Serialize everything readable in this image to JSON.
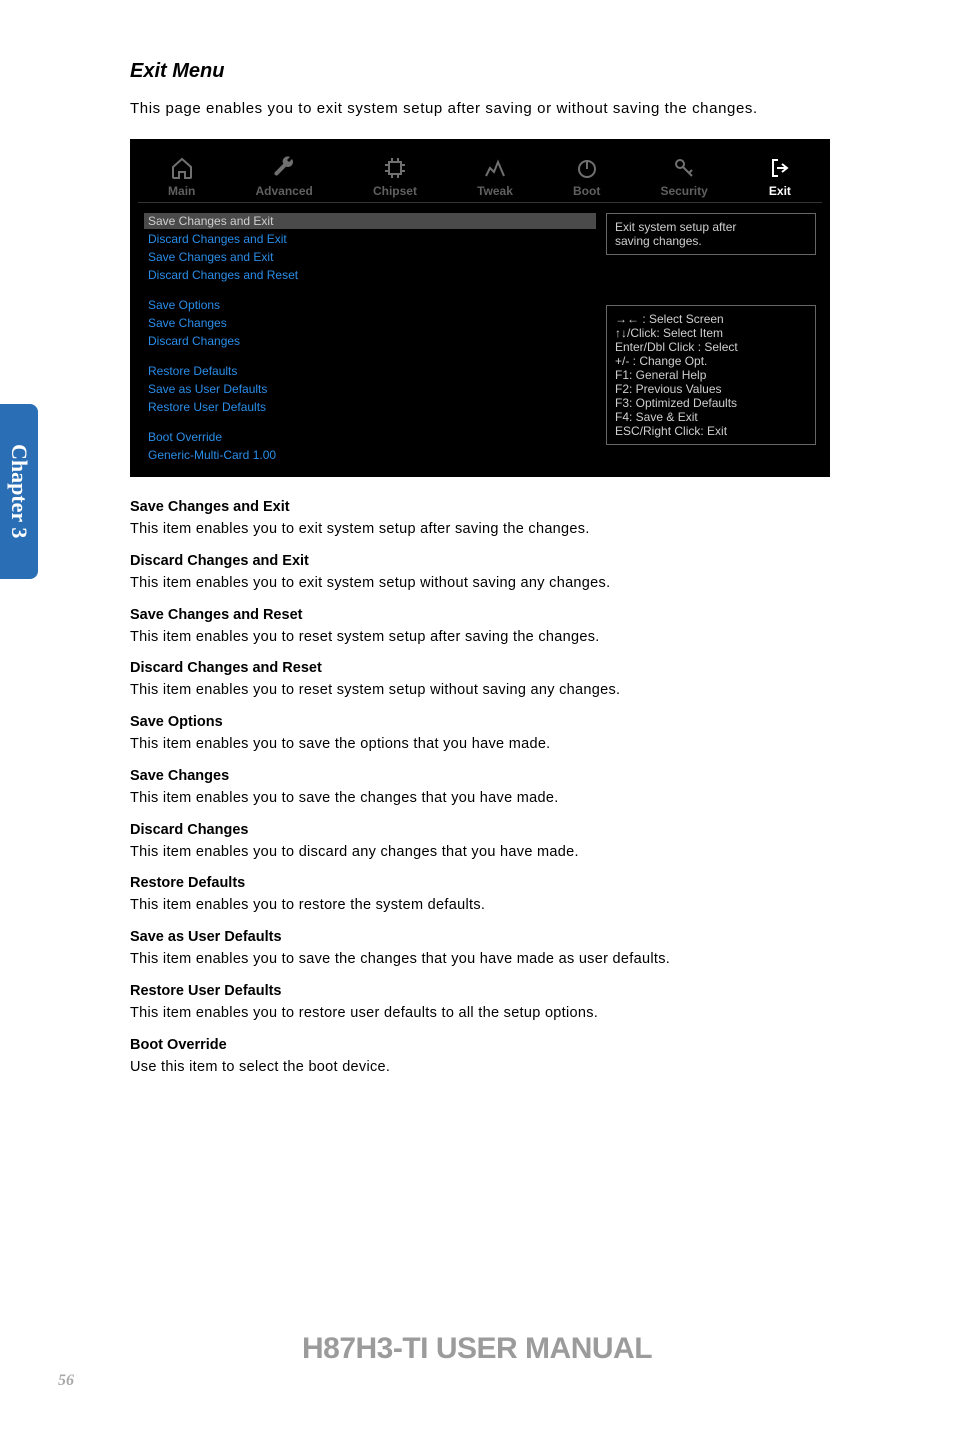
{
  "sideTab": "Chapter 3",
  "heading": "Exit Menu",
  "intro": "This page enables you to exit system setup after saving or without saving the changes.",
  "bios": {
    "tabs": [
      "Main",
      "Advanced",
      "Chipset",
      "Tweak",
      "Boot",
      "Security",
      "Exit"
    ],
    "leftGroups": {
      "g1": [
        {
          "label": "Save Changes and Exit",
          "sel": true
        },
        {
          "label": "Discard Changes and Exit"
        },
        {
          "label": "Save Changes and Exit"
        },
        {
          "label": "Discard Changes and Reset"
        }
      ],
      "g2": [
        {
          "label": "Save Options"
        },
        {
          "label": "Save Changes"
        },
        {
          "label": "Discard Changes"
        }
      ],
      "g3": [
        {
          "label": "Restore Defaults"
        },
        {
          "label": "Save as User Defaults"
        },
        {
          "label": "Restore User Defaults"
        }
      ],
      "g4": [
        {
          "label": "Boot Override"
        },
        {
          "label": "Generic-Multi-Card 1.00"
        }
      ]
    },
    "help": {
      "top1": "Exit system setup after",
      "top2": "saving changes.",
      "l1": "→←  : Select Screen",
      "l2": "↑↓/Click: Select Item",
      "l3": "Enter/Dbl Click : Select",
      "l4": "+/- : Change Opt.",
      "l5": "F1: General Help",
      "l6": "F2: Previous Values",
      "l7": "F3: Optimized Defaults",
      "l8": "F4: Save & Exit",
      "l9": "ESC/Right Click: Exit"
    }
  },
  "descriptions": [
    {
      "b": "Save Changes and Exit",
      "t": "This item enables you to exit system setup after saving the changes."
    },
    {
      "b": "Discard Changes and Exit",
      "t": "This item enables you to exit system setup without saving any changes."
    },
    {
      "b": "Save Changes and Reset",
      "t": "This item enables you to reset system setup after saving the changes."
    },
    {
      "b": "Discard Changes and Reset",
      "t": "This item enables you to reset system setup without saving any changes."
    },
    {
      "b": "Save Options",
      "t": "This item enables you to save the options that you have made."
    },
    {
      "b": "Save Changes",
      "t": "This item enables you to save the changes that you have made."
    },
    {
      "b": "Discard Changes",
      "t": "This item enables you to discard any changes that you have made."
    },
    {
      "b": "Restore Defaults",
      "t": "This item enables you to restore the system defaults."
    },
    {
      "b": "Save as User Defaults",
      "t": "This item enables you to save the changes that you have made as user defaults."
    },
    {
      "b": "Restore User Defaults",
      "t": "This item enables you to restore user defaults to all the setup options."
    },
    {
      "b": "Boot Override",
      "t": "Use this item to select the boot device."
    }
  ],
  "footerTitle": "H87H3-TI USER MANUAL",
  "pageNum": "56"
}
